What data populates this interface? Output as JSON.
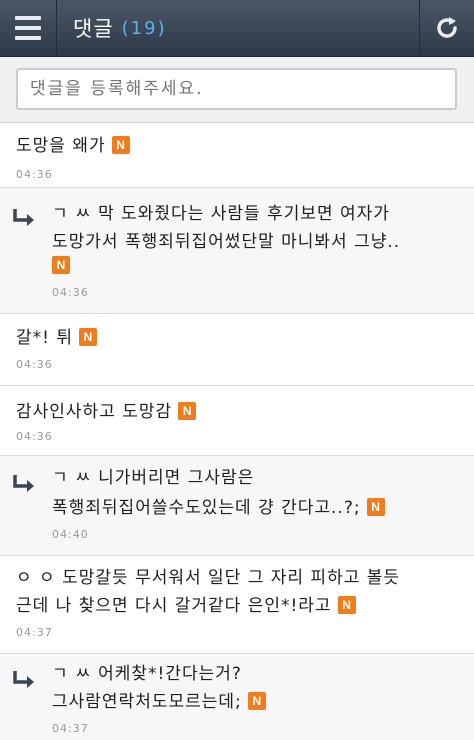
{
  "header": {
    "title": "댓글",
    "count": "(19)",
    "menu_icon": "hamburger-menu-icon",
    "refresh_icon": "refresh-icon"
  },
  "comment_input": {
    "placeholder": "댓글을 등록해주세요."
  },
  "badge_label": "N",
  "colors": {
    "header_bg": "#3a4654",
    "accent_count": "#5fb0e6",
    "badge": "#f07d1d"
  },
  "comments": [
    {
      "text": "도망을 왜가",
      "time": "04:36",
      "reply": false
    },
    {
      "text_lines": [
        "ㄱ ㅆ 막 도와줬다는 사람들 후기보면 여자가",
        "도망가서 폭행죄뒤집어썼단말 마니봐서 그냥.."
      ],
      "time": "04:36",
      "reply": true
    },
    {
      "text": "갈*! 튀",
      "time": "04:36",
      "reply": false
    },
    {
      "text": "감사인사하고 도망감",
      "time": "04:36",
      "reply": false
    },
    {
      "text_lines": [
        "ㄱ ㅆ 니가버리면 그사람은",
        "폭행죄뒤집어쓸수도있는데 걍 간다고..?;"
      ],
      "time": "04:40",
      "reply": true
    },
    {
      "text_lines": [
        "ㅇ ㅇ 도망갈듯 무서워서 일단 그 자리 피하고 볼듯",
        "근데 나 찾으면 다시 갈거같다 은인*!라고"
      ],
      "time": "04:37",
      "reply": false
    },
    {
      "text_lines": [
        "ㄱ ㅆ 어케찾*!간다는거?",
        "그사람연락처도모르는데;"
      ],
      "time": "04:37",
      "reply": true
    }
  ]
}
